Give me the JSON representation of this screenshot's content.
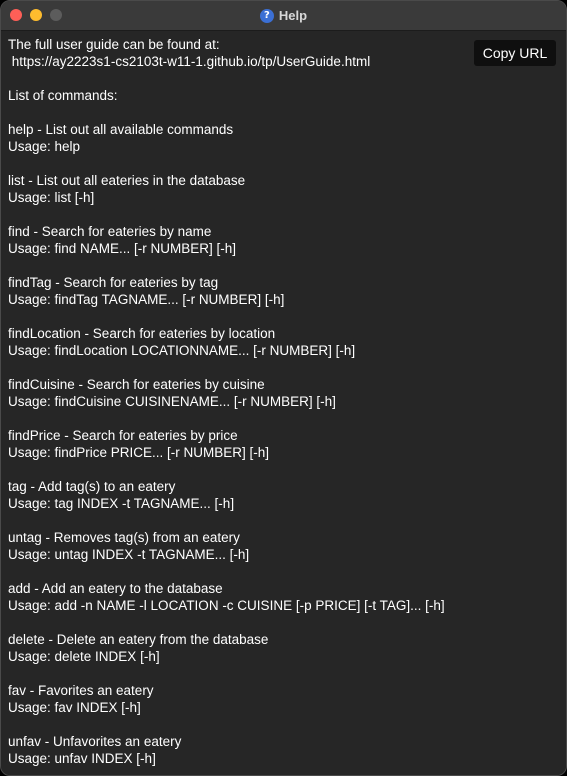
{
  "window": {
    "title": "Help",
    "icon": "question-mark-icon"
  },
  "help": {
    "lines": [
      "The full user guide can be found at:",
      " https://ay2223s1-cs2103t-w11-1.github.io/tp/UserGuide.html",
      "",
      "List of commands:",
      "",
      "help - List out all available commands",
      "Usage: help",
      "",
      "list - List out all eateries in the database",
      "Usage: list [-h]",
      "",
      "find - Search for eateries by name",
      "Usage: find NAME... [-r NUMBER] [-h]",
      "",
      "findTag - Search for eateries by tag",
      "Usage: findTag TAGNAME... [-r NUMBER] [-h]",
      "",
      "findLocation - Search for eateries by location",
      "Usage: findLocation LOCATIONNAME... [-r NUMBER] [-h]",
      "",
      "findCuisine - Search for eateries by cuisine",
      "Usage: findCuisine CUISINENAME... [-r NUMBER] [-h]",
      "",
      "findPrice - Search for eateries by price",
      "Usage: findPrice PRICE... [-r NUMBER] [-h]",
      "",
      "tag - Add tag(s) to an eatery",
      "Usage: tag INDEX -t TAGNAME... [-h]",
      "",
      "untag - Removes tag(s) from an eatery",
      "Usage: untag INDEX -t TAGNAME... [-h]",
      "",
      "add - Add an eatery to the database",
      "Usage: add -n NAME -l LOCATION -c CUISINE [-p PRICE] [-t TAG]... [-h]",
      "",
      "delete - Delete an eatery from the database",
      "Usage: delete INDEX [-h]",
      "",
      "fav - Favorites an eatery",
      "Usage: fav INDEX [-h]",
      "",
      "unfav - Unfavorites an eatery",
      "Usage: unfav INDEX [-h]"
    ]
  },
  "actions": {
    "copy_url_label": "Copy URL"
  },
  "colors": {
    "background": "#262626",
    "titlebar": "#3a3a3a",
    "text": "#ffffff",
    "button_bg": "#0f0f0f",
    "close": "#fe5f57",
    "minimize": "#febc2e",
    "zoom_disabled": "#5c5c5c"
  }
}
